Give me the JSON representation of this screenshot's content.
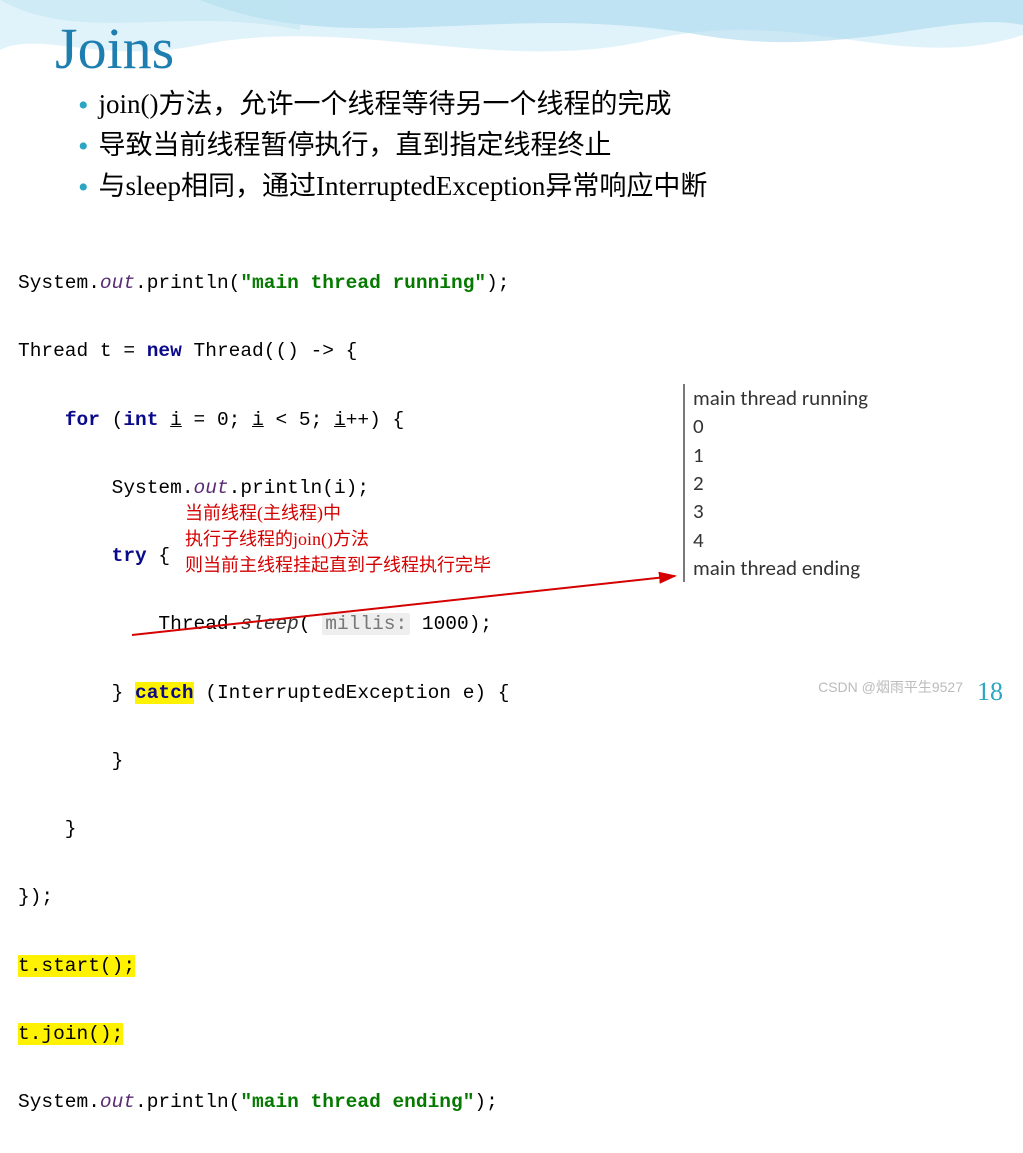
{
  "title": "Joins",
  "bullets": [
    "join()方法，允许一个线程等待另一个线程的完成",
    "导致当前线程暂停执行，直到指定线程终止",
    "与sleep相同，通过InterruptedException异常响应中断"
  ],
  "code": {
    "l1a": "System.",
    "l1b": "out",
    "l1c": ".println(",
    "l1d": "\"main thread running\"",
    "l1e": ");",
    "l2a": "Thread t = ",
    "l2b": "new",
    "l2c": " Thread(() -> {",
    "l3a": "    ",
    "l3b": "for",
    "l3c": " (",
    "l3d": "int",
    "l3e": " ",
    "l3f": "i",
    "l3g": " = 0; ",
    "l3h": "i",
    "l3i": " < 5; ",
    "l3j": "i",
    "l3k": "++) {",
    "l4a": "        System.",
    "l4b": "out",
    "l4c": ".println(i);",
    "l5a": "        ",
    "l5b": "try",
    "l5c": " {",
    "l6a": "            Thread.",
    "l6b": "sleep",
    "l6c": "( ",
    "l6hint": "millis:",
    "l6d": " 1000);",
    "l7a": "        } ",
    "l7b": "catch",
    "l7c": " (InterruptedException e) {",
    "l8": "        }",
    "l9": "    }",
    "l10": "});",
    "l11": "t.start();",
    "l12": "t.join();",
    "l13a": "System.",
    "l13b": "out",
    "l13c": ".println(",
    "l13d": "\"main thread ending\"",
    "l13e": ");"
  },
  "annotation": {
    "line1": "当前线程(主线程)中",
    "line2": "执行子线程的join()方法",
    "line3": "则当前主线程挂起直到子线程执行完毕"
  },
  "output": [
    "main thread running",
    "0",
    "1",
    "2",
    "3",
    "4",
    "main thread ending"
  ],
  "slide_number": "18",
  "watermark": "CSDN @烟雨平生9527"
}
